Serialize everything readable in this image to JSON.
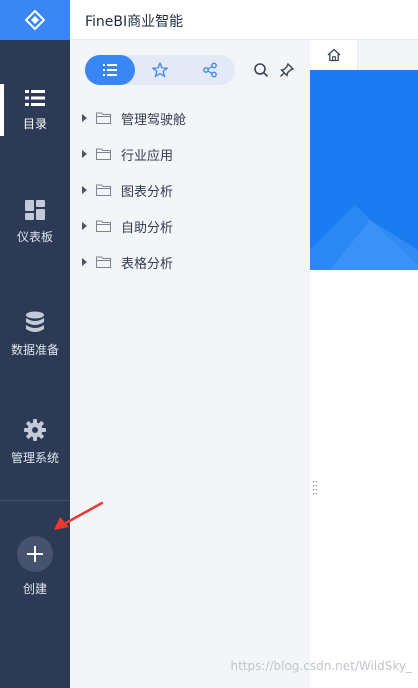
{
  "header": {
    "title": "FineBI商业智能"
  },
  "nav": {
    "items": [
      {
        "label": "目录",
        "icon": "list-icon",
        "active": true
      },
      {
        "label": "仪表板",
        "icon": "dashboard-icon",
        "active": false
      },
      {
        "label": "数据准备",
        "icon": "database-icon",
        "active": false
      },
      {
        "label": "管理系统",
        "icon": "gear-icon",
        "active": false
      }
    ],
    "create_label": "创建"
  },
  "panel": {
    "tabs": [
      {
        "icon": "list-icon",
        "active": true
      },
      {
        "icon": "star-icon",
        "active": false
      },
      {
        "icon": "share-icon",
        "active": false
      }
    ],
    "tree": [
      {
        "label": "管理驾驶舱"
      },
      {
        "label": "行业应用"
      },
      {
        "label": "图表分析"
      },
      {
        "label": "自助分析"
      },
      {
        "label": "表格分析"
      }
    ]
  },
  "watermark": "https://blog.csdn.net/WildSky_",
  "colors": {
    "nav_bg": "#2c3a55",
    "accent": "#3a86f5",
    "panel_bg": "#f3f5f9",
    "arrow": "#e83a30"
  }
}
